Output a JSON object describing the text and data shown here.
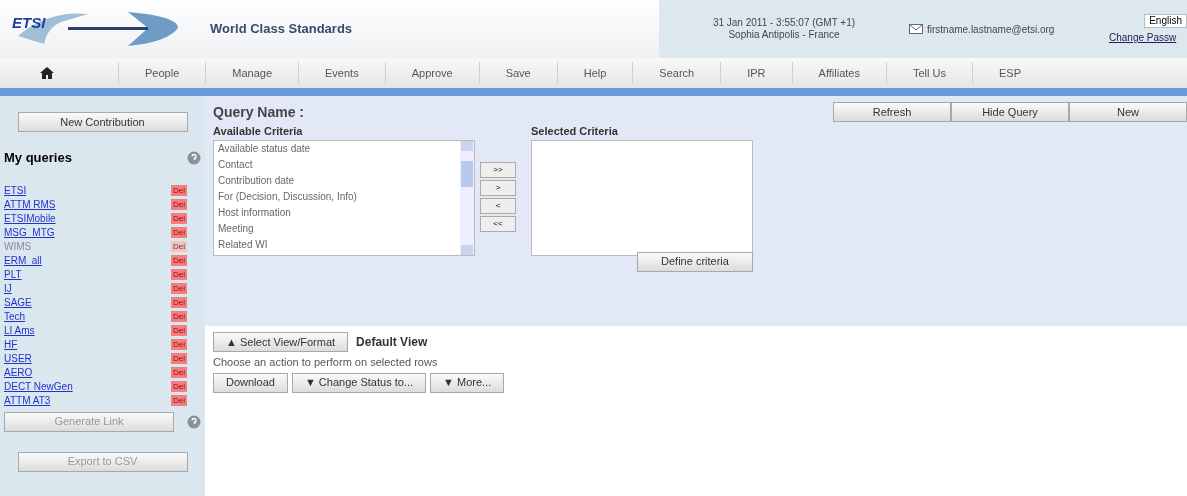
{
  "header": {
    "logo_text": "ETSI",
    "tagline": "World Class Standards",
    "datetime": "31 Jan 2011 - 3:55:07 (GMT +1)",
    "location": "Sophia Antipolis - France",
    "email": "firstname.lastname@etsi.org",
    "language": "English",
    "account_link": "Change Passw"
  },
  "nav": [
    {
      "label": "People"
    },
    {
      "label": "Manage"
    },
    {
      "label": "Events"
    },
    {
      "label": "Approve"
    },
    {
      "label": "Save"
    },
    {
      "label": "Help"
    },
    {
      "label": "Search"
    },
    {
      "label": "IPR"
    },
    {
      "label": "Affiliates"
    },
    {
      "label": "Tell Us"
    },
    {
      "label": "ESP"
    }
  ],
  "sidebar": {
    "new_button": "New Contribution",
    "title": "My queries",
    "queries": [
      {
        "name": "ETSI",
        "active": true,
        "delete": "Del"
      },
      {
        "name": "ATTM RMS",
        "active": true,
        "delete": "Del"
      },
      {
        "name": "ETSIMobile",
        "active": true,
        "delete": "Del"
      },
      {
        "name": "MSG_MTG",
        "active": true,
        "delete": "Del"
      },
      {
        "name": "WIMS",
        "active": false,
        "delete": "Del"
      },
      {
        "name": "ERM_all",
        "active": true,
        "delete": "Del"
      },
      {
        "name": "PLT",
        "active": true,
        "delete": "Del"
      },
      {
        "name": "IJ",
        "active": true,
        "delete": "Del"
      },
      {
        "name": "SAGE",
        "active": true,
        "delete": "Del"
      },
      {
        "name": "Tech",
        "active": true,
        "delete": "Del"
      },
      {
        "name": "LI Ams",
        "active": true,
        "delete": "Del"
      },
      {
        "name": "HF",
        "active": true,
        "delete": "Del"
      },
      {
        "name": "USER",
        "active": true,
        "delete": "Del"
      },
      {
        "name": "AERO",
        "active": true,
        "delete": "Del"
      },
      {
        "name": "DECT NewGen",
        "active": true,
        "delete": "Del"
      },
      {
        "name": "ATTM AT3",
        "active": true,
        "delete": "Del"
      }
    ],
    "link_button": "Generate Link",
    "export_button": "Export to CSV"
  },
  "query": {
    "name_label": "Query Name :",
    "available_label": "Available Criteria",
    "available": [
      "Available status date",
      "Contact",
      "Contribution date",
      "For (Decision, Discussion, Info)",
      "Host information",
      "Meeting",
      "Related WI"
    ],
    "move_buttons": [
      ">>",
      ">",
      "<",
      "<<"
    ],
    "selected_label": "Selected Criteria",
    "define_button": "Define criteria",
    "actions": [
      "Refresh",
      "Hide Query",
      "New"
    ]
  },
  "results": {
    "view_button": "▲ Select View/Format",
    "view_name": "Default View",
    "hint": "Choose an action to perform on selected rows",
    "buttons": [
      "Download",
      "▼ Change Status to...",
      "▼ More..."
    ]
  }
}
